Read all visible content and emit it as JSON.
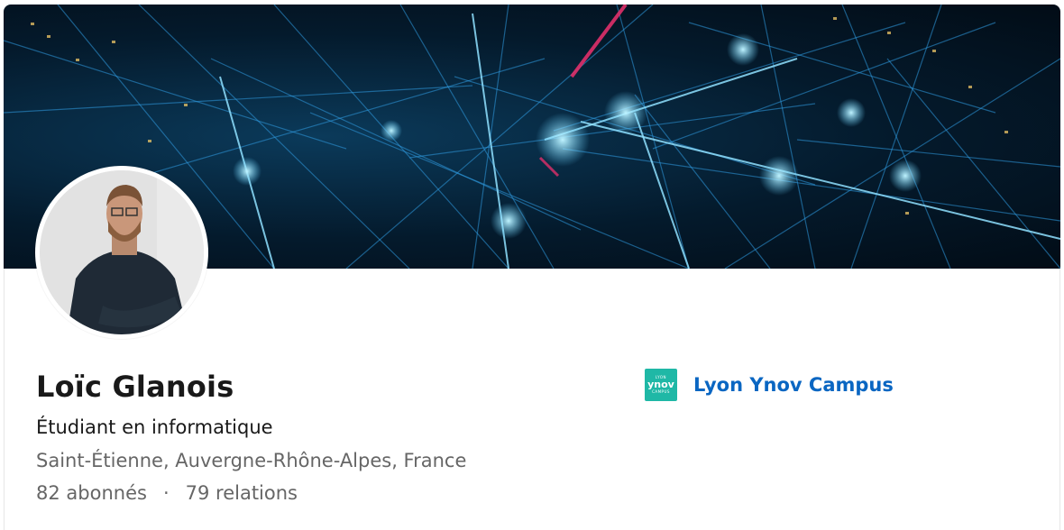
{
  "profile": {
    "name": "Loïc Glanois",
    "headline": "Étudiant en informatique",
    "location": "Saint-Étienne, Auvergne-Rhône-Alpes, France",
    "followers": "82 abonnés",
    "separator": "·",
    "connections": "79 relations"
  },
  "education": {
    "school_name": "Lyon Ynov Campus",
    "logo_top": "LYON",
    "logo_main": "ynov",
    "logo_bottom": "CAMPUS",
    "logo_color": "#1fb8a6"
  },
  "colors": {
    "link": "#0a66c2",
    "text_primary": "#191919",
    "text_secondary": "#666666"
  }
}
